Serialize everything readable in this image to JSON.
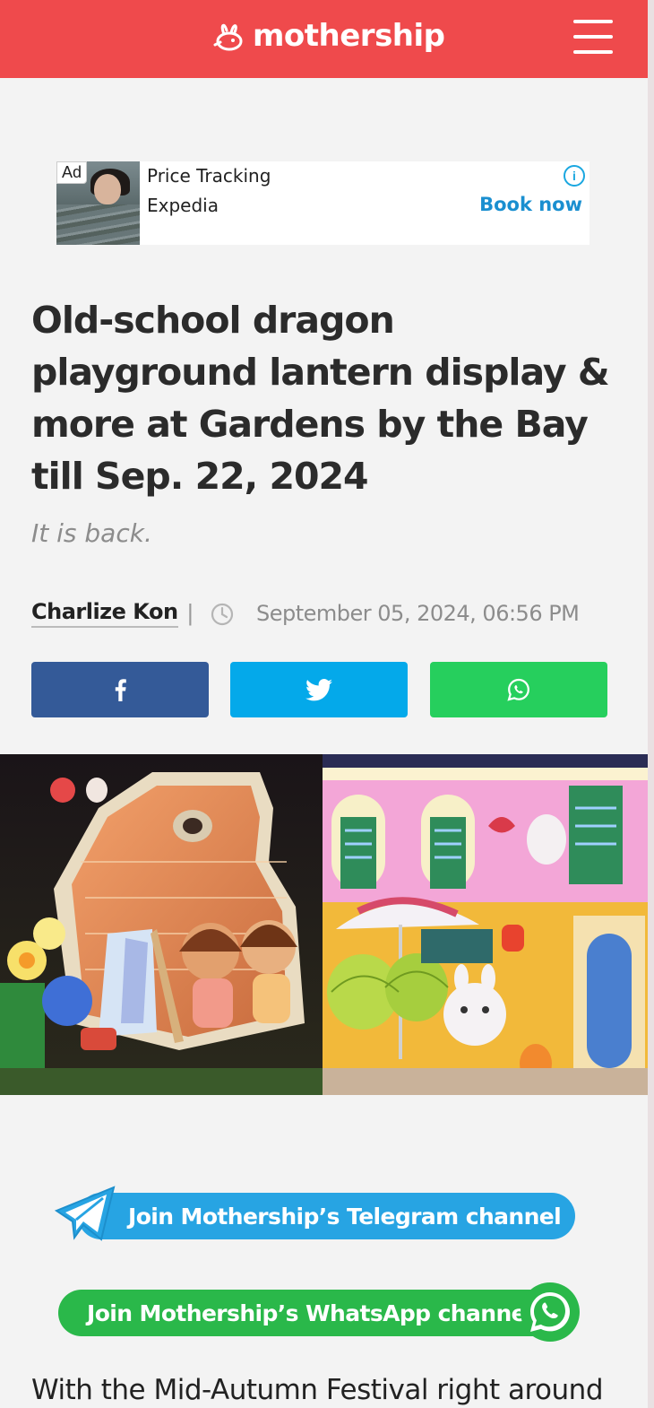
{
  "header": {
    "logo_text": "mothership",
    "logo_icon": "bunny-mark-icon",
    "menu_icon": "hamburger-menu-icon",
    "brand_color": "#ef4a4c"
  },
  "ad": {
    "badge": "Ad",
    "title": "Price Tracking",
    "sponsor": "Expedia",
    "info_glyph": "i",
    "cta": "Book now",
    "cta_color": "#1a8fd0"
  },
  "article": {
    "title": "Old-school dragon playground lantern display & more at Gardens by the Bay till Sep. 22, 2024",
    "subtitle": "It is back.",
    "author": "Charlize Kon",
    "separator": "|",
    "date": "September 05, 2024, 06:56 PM",
    "body_start": "With the Mid-Autumn Festival right around"
  },
  "share": {
    "facebook": {
      "icon": "facebook-icon",
      "color": "#345a98"
    },
    "twitter": {
      "icon": "twitter-icon",
      "color": "#04a9ea"
    },
    "whatsapp": {
      "icon": "whatsapp-icon",
      "color": "#26cf5d"
    }
  },
  "cta": {
    "telegram_label": "Join Mothership’s Telegram channel",
    "telegram_color": "#27a4e3",
    "whatsapp_label": "Join Mothership’s WhatsApp channel",
    "whatsapp_color": "#2ab84a"
  }
}
